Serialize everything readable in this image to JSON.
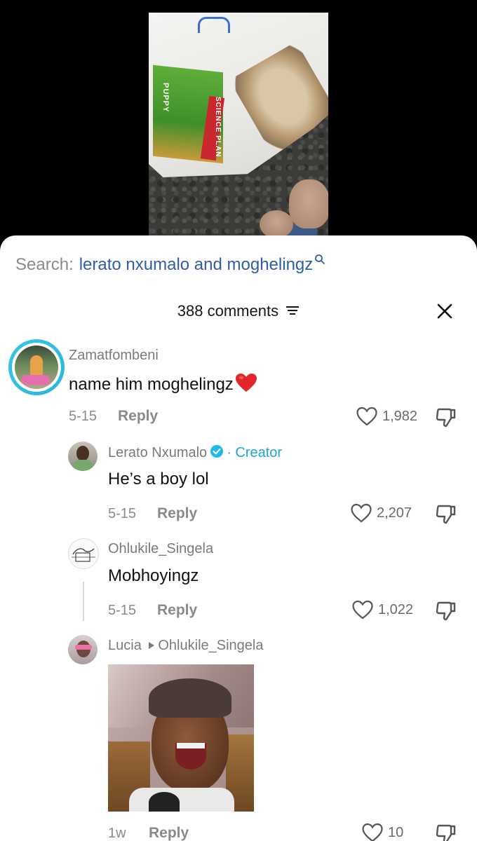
{
  "search": {
    "label": "Search:",
    "query": "lerato nxumalo and moghelingz"
  },
  "header": {
    "comment_count": "388 comments"
  },
  "video": {
    "bag_text": "PUPPY",
    "bag_brand": "SCIENCE PLAN"
  },
  "comments": [
    {
      "username": "Zamatfombeni",
      "text": "name him moghelingz",
      "emoji": "❤️",
      "date": "5-15",
      "reply_label": "Reply",
      "likes": "1,982"
    },
    {
      "username": "Lerato Nxumalo",
      "creator_label": "· Creator",
      "text": "He’s a boy lol",
      "date": "5-15",
      "reply_label": "Reply",
      "likes": "2,207"
    },
    {
      "username": "Ohlukile_Singela",
      "text": "Mobhoyingz",
      "date": "5-15",
      "reply_label": "Reply",
      "likes": "1,022"
    },
    {
      "username": "Lucia",
      "reply_to": "Ohlukile_Singela",
      "date": "1w",
      "reply_label": "Reply",
      "likes": "10"
    }
  ],
  "colors": {
    "accent": "#2f5ea8",
    "creator": "#1fa5d6",
    "heart_emoji": "#e2262c"
  }
}
